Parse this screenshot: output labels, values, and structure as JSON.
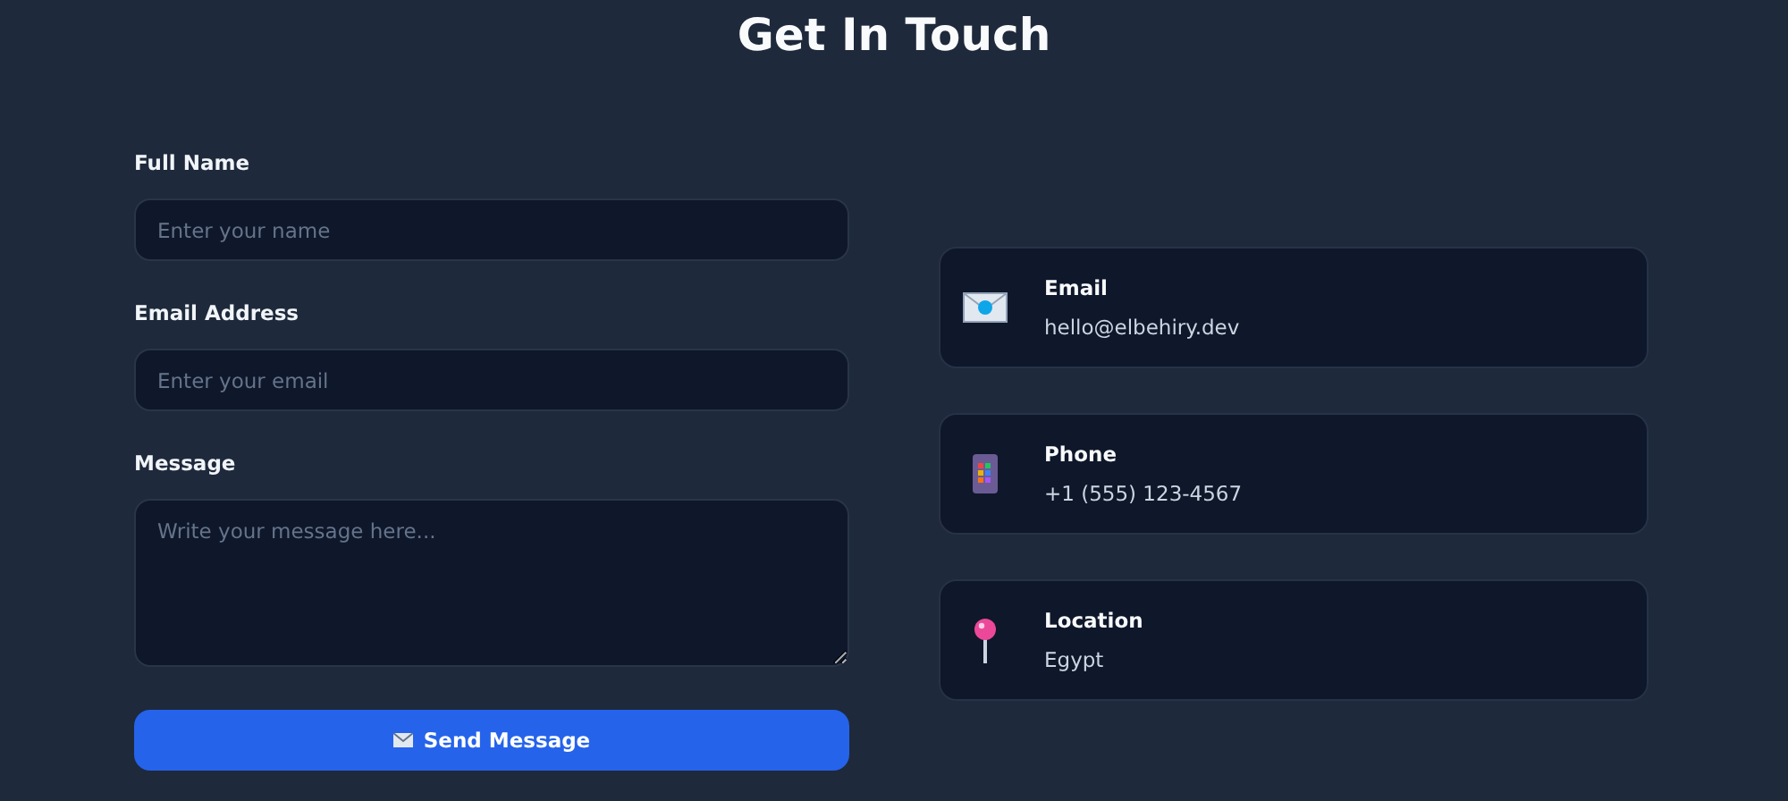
{
  "title": "Get In Touch",
  "form": {
    "fields": [
      {
        "kind": "input",
        "label": "Full Name",
        "placeholder": "Enter your name"
      },
      {
        "kind": "input",
        "label": "Email Address",
        "placeholder": "Enter your email"
      },
      {
        "kind": "textarea",
        "label": "Message",
        "placeholder": "Write your message here..."
      }
    ],
    "submit": {
      "label": "Send Message"
    }
  },
  "contacts": [
    {
      "kind": "email",
      "label": "Email",
      "value": "hello@elbehiry.dev"
    },
    {
      "kind": "phone",
      "label": "Phone",
      "value": "+1 (555) 123-4567"
    },
    {
      "kind": "location",
      "label": "Location",
      "value": "Egypt"
    }
  ]
}
